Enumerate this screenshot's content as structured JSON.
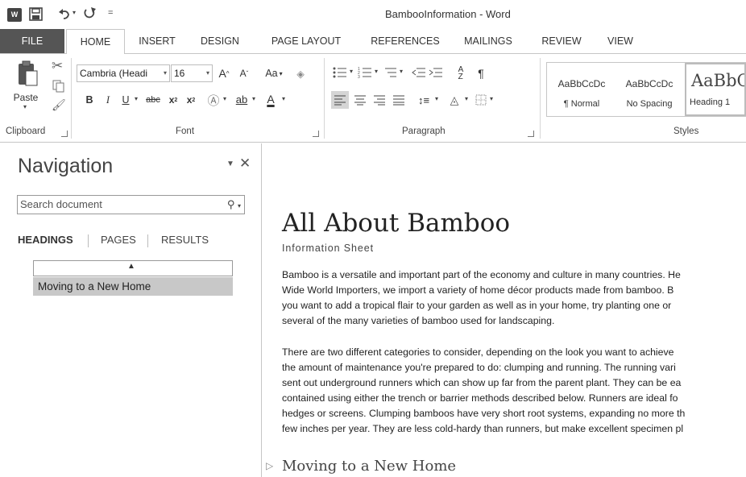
{
  "window": {
    "title": "BambooInformation - Word"
  },
  "qat": {
    "word_icon": "word-icon",
    "save": "save-icon",
    "undo": "undo-icon",
    "redo": "redo-icon",
    "customize": "customize-qat-icon"
  },
  "tabs": [
    {
      "label": "FILE"
    },
    {
      "label": "HOME"
    },
    {
      "label": "INSERT"
    },
    {
      "label": "DESIGN"
    },
    {
      "label": "PAGE LAYOUT"
    },
    {
      "label": "REFERENCES"
    },
    {
      "label": "MAILINGS"
    },
    {
      "label": "REVIEW"
    },
    {
      "label": "VIEW"
    }
  ],
  "ribbon": {
    "clipboard": {
      "paste": "Paste",
      "label": "Clipboard"
    },
    "font": {
      "name": "Cambria (Headi",
      "size": "16",
      "label": "Font",
      "aa": "Aa"
    },
    "paragraph": {
      "label": "Paragraph"
    },
    "styles": {
      "label": "Styles",
      "items": [
        {
          "sample": "AaBbCcDc",
          "name": "¶ Normal"
        },
        {
          "sample": "AaBbCcDc",
          "name": "No Spacing"
        },
        {
          "sample": "AaBbC",
          "name": "Heading 1"
        }
      ]
    }
  },
  "nav": {
    "title": "Navigation",
    "search_placeholder": "Search document",
    "tabs": [
      {
        "label": "HEADINGS"
      },
      {
        "label": "PAGES"
      },
      {
        "label": "RESULTS"
      }
    ],
    "headings": [
      "Moving to a New Home"
    ]
  },
  "doc": {
    "title": "All About Bamboo",
    "subtitle": "Information Sheet",
    "para1": [
      "Bamboo is a versatile and important part of the economy and culture in many countries. He",
      "Wide World Importers, we import a variety of home décor products made from bamboo. B",
      "you want to add a tropical flair to your garden as well as in your home, try planting one or",
      "several of the many varieties of bamboo used for landscaping."
    ],
    "para2": [
      "There are two different categories to consider, depending on the look you want to achieve",
      "the amount of maintenance you're prepared to do: clumping and running. The running vari",
      "sent out underground runners which can show up far from the parent plant. They can be ea",
      "contained using either the trench or barrier methods described below. Runners are ideal fo",
      "hedges or screens. Clumping bamboos have very short root systems, expanding no more th",
      "few inches per year. They are less cold-hardy than runners, but make excellent specimen pl"
    ],
    "heading1": "Moving to a New Home"
  }
}
